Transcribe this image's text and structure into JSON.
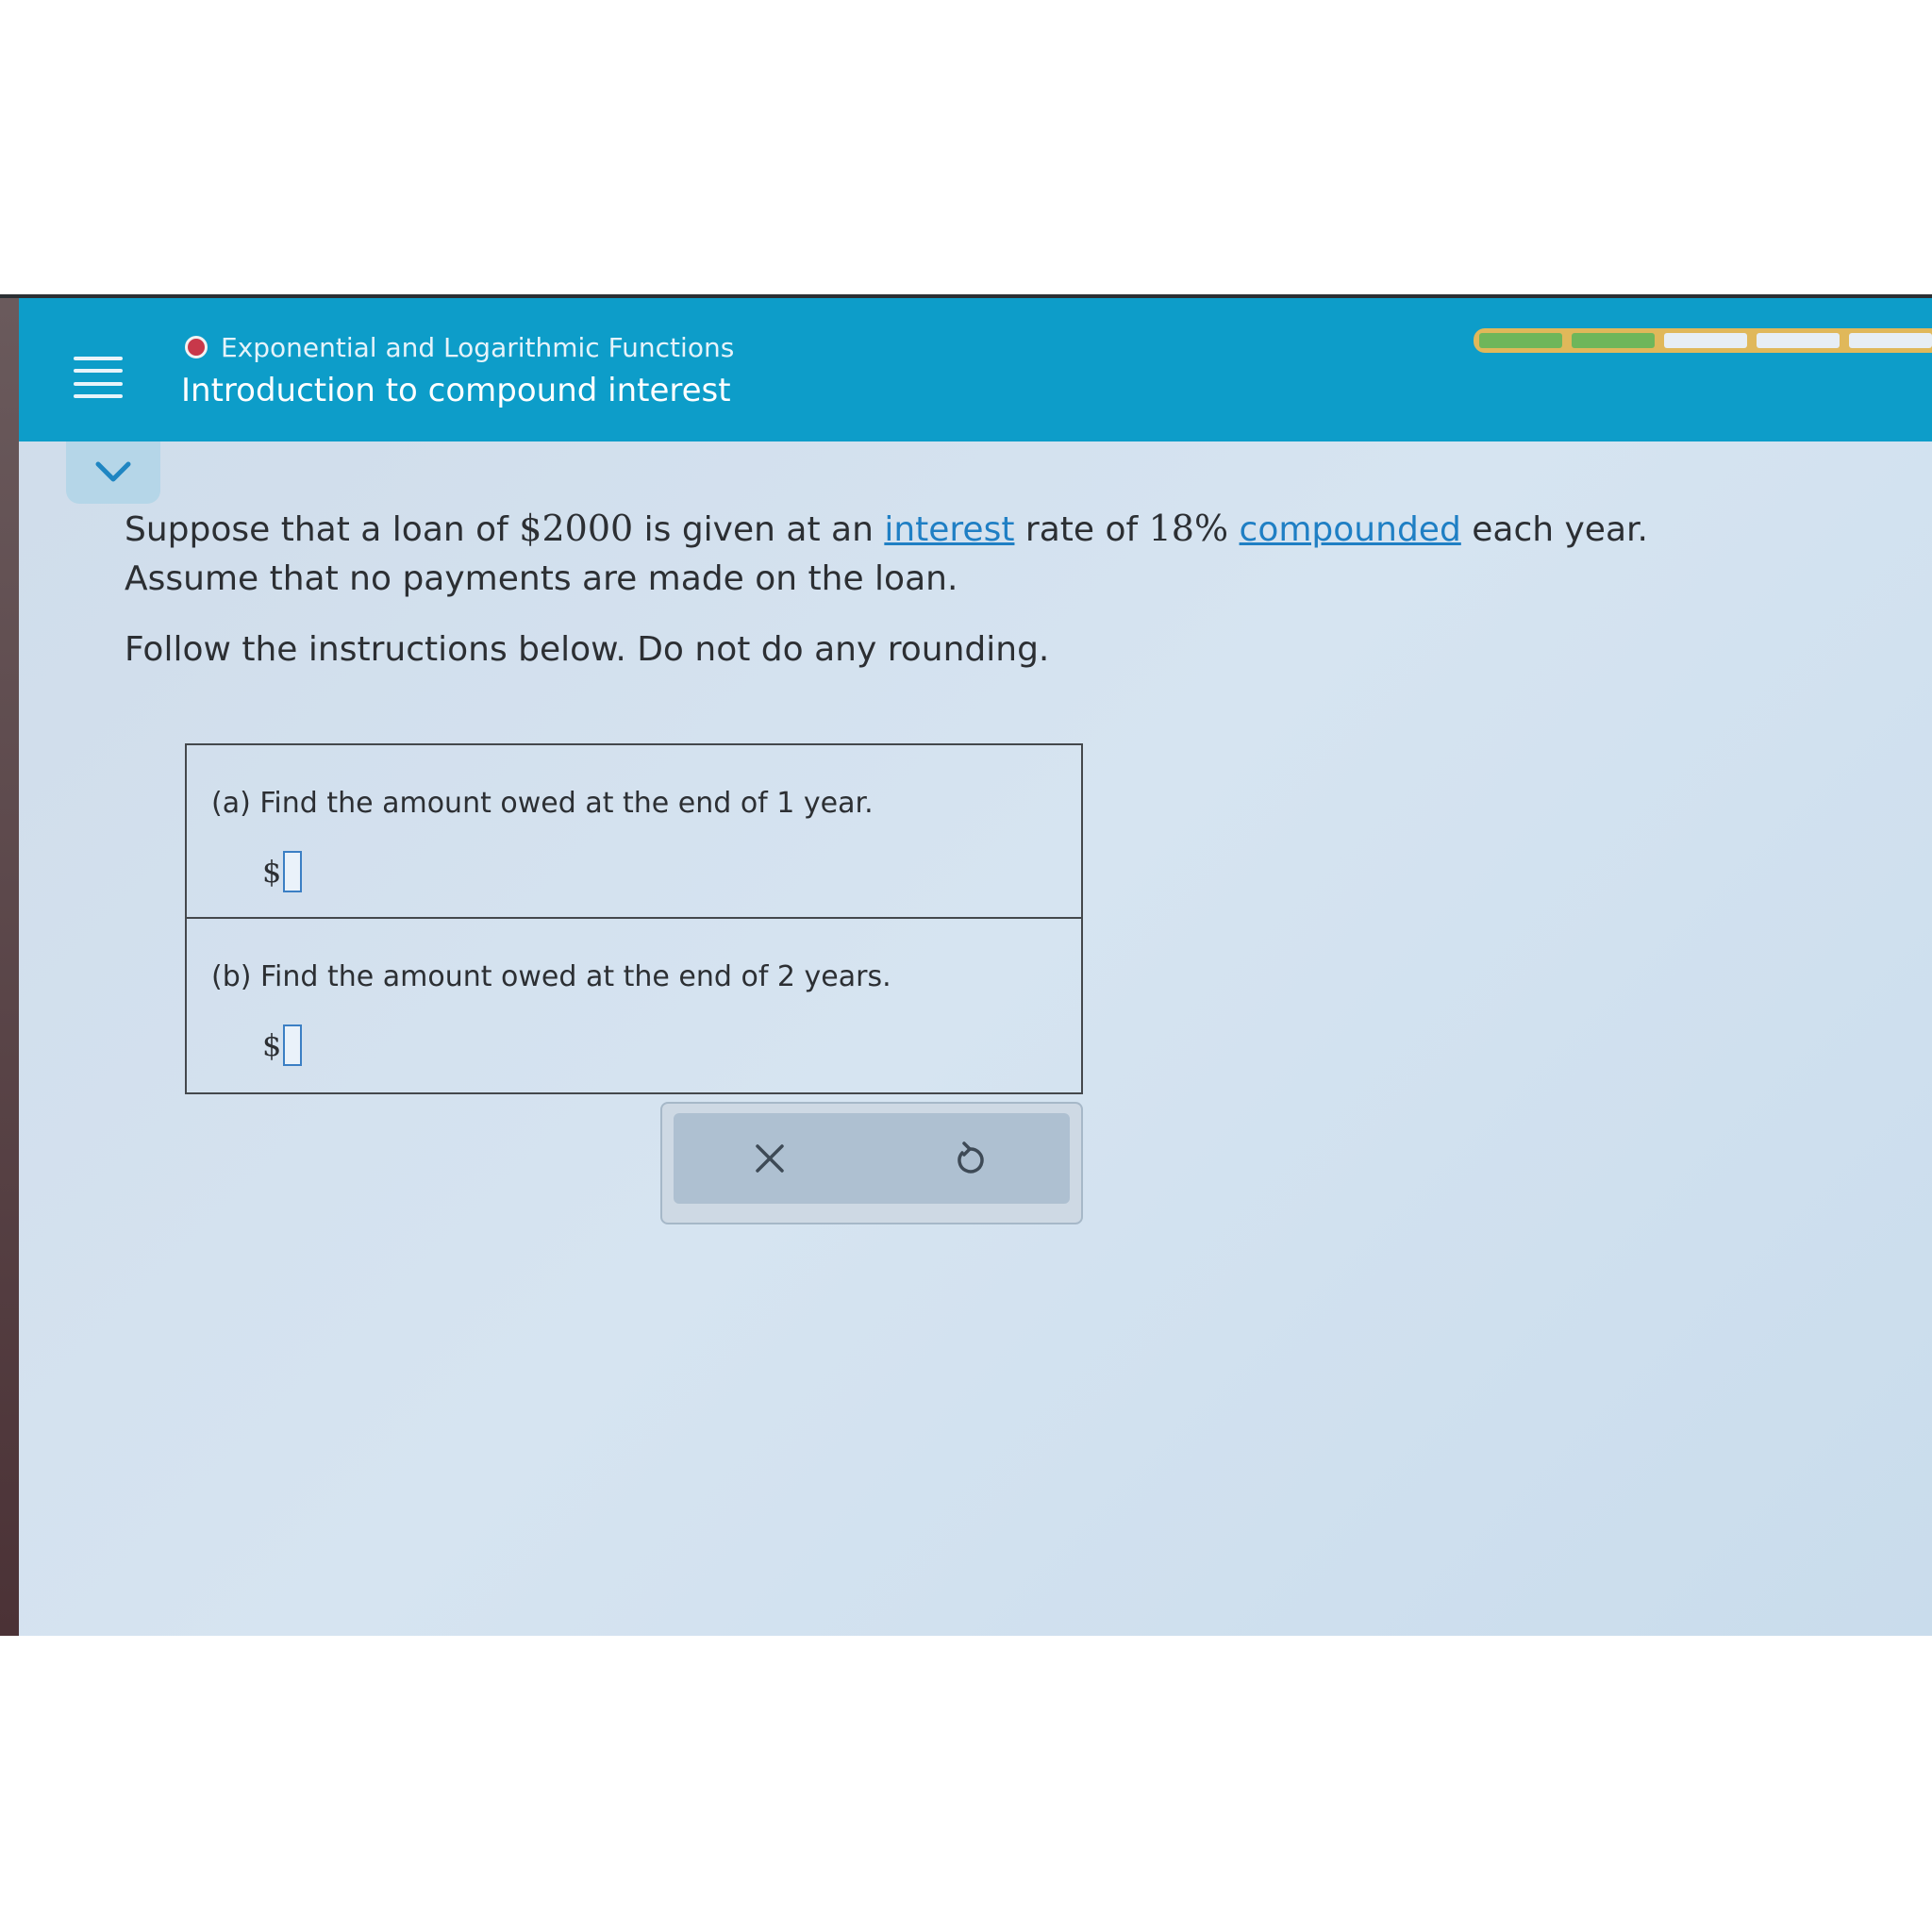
{
  "header": {
    "category": "Exponential and Logarithmic Functions",
    "topic": "Introduction to compound interest",
    "progress": {
      "completed_segments": 2,
      "total_segments": 6
    },
    "category_dot_color": "#c8384a",
    "bar_color": "#0d9dc9"
  },
  "problem": {
    "s1": "Suppose that a loan of ",
    "principal": "$2000",
    "s2": " is given at an ",
    "link_interest": "interest",
    "s3": " rate of ",
    "rate": "18%",
    "s4": " ",
    "link_compounded": "compounded",
    "s5": " each year.",
    "line2": "Assume that no payments are made on the loan.",
    "instructions": "Follow the instructions below. Do not do any rounding."
  },
  "parts": [
    {
      "label": "(a) Find the amount owed at the end of 1 year.",
      "currency": "$",
      "value": ""
    },
    {
      "label": "(b) Find the amount owed at the end of 2 years.",
      "currency": "$",
      "value": ""
    }
  ],
  "icons": {
    "menu": "menu-icon",
    "collapse": "chevron-down-icon",
    "clear": "close-icon",
    "undo": "undo-icon"
  }
}
